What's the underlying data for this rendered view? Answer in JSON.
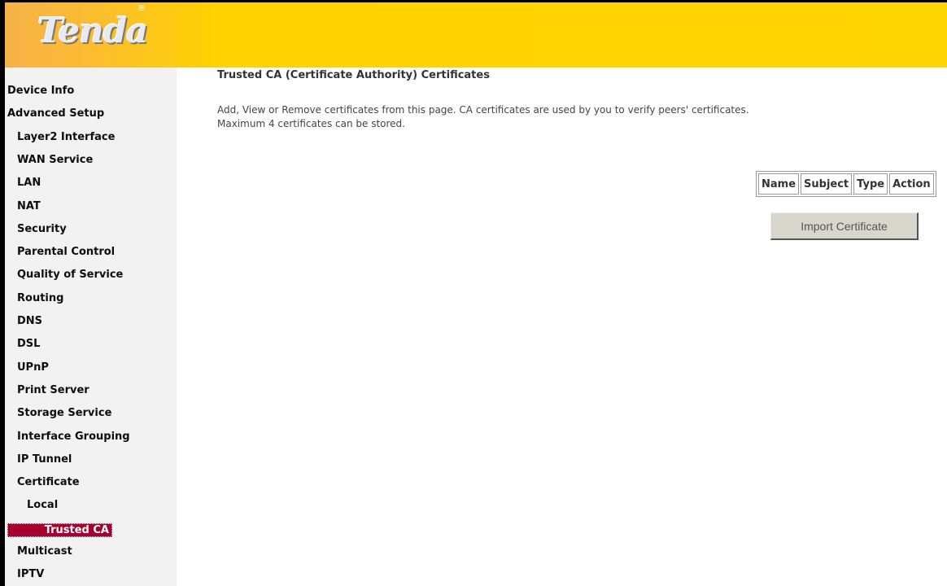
{
  "brand": {
    "logo_text": "Tenda",
    "logo_mark": "®"
  },
  "sidebar": {
    "items": [
      {
        "label": "Device Info",
        "level": 0
      },
      {
        "label": "Advanced Setup",
        "level": 0
      },
      {
        "label": "Layer2 Interface",
        "level": 1
      },
      {
        "label": "WAN Service",
        "level": 1
      },
      {
        "label": "LAN",
        "level": 1
      },
      {
        "label": "NAT",
        "level": 1
      },
      {
        "label": "Security",
        "level": 1
      },
      {
        "label": "Parental Control",
        "level": 1
      },
      {
        "label": "Quality of Service",
        "level": 1
      },
      {
        "label": "Routing",
        "level": 1
      },
      {
        "label": "DNS",
        "level": 1
      },
      {
        "label": "DSL",
        "level": 1
      },
      {
        "label": "UPnP",
        "level": 1
      },
      {
        "label": "Print Server",
        "level": 1
      },
      {
        "label": "Storage Service",
        "level": 1
      },
      {
        "label": "Interface Grouping",
        "level": 1
      },
      {
        "label": "IP Tunnel",
        "level": 1
      },
      {
        "label": "Certificate",
        "level": 1
      },
      {
        "label": "Local",
        "level": 2
      },
      {
        "label": "Trusted CA",
        "level": 2,
        "active": true
      },
      {
        "label": "Multicast",
        "level": 1
      },
      {
        "label": "IPTV",
        "level": 1
      }
    ]
  },
  "main": {
    "title": "Trusted CA (Certificate Authority) Certificates",
    "description_line1": "Add, View or Remove certificates from this page. CA certificates are used by you to verify peers' certificates.",
    "description_line2": "Maximum 4 certificates can be stored.",
    "table_headers": [
      "Name",
      "Subject",
      "Type",
      "Action"
    ],
    "import_button_label": "Import Certificate"
  },
  "colors": {
    "header_yellow": "#ffd500",
    "active_nav_bg": "#a6002e",
    "sidebar_bg": "#f2f2f2"
  }
}
